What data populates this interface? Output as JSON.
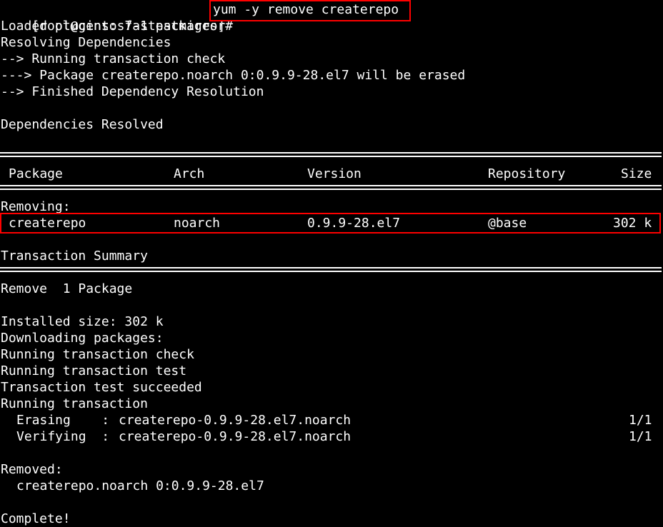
{
  "prompt": "[root@centos7-1 packages]#",
  "command": "yum -y remove createrepo",
  "lines": {
    "loaded_plugins": "Loaded plugins: fastestmirror",
    "resolving": "Resolving Dependencies",
    "running_check": "--> Running transaction check",
    "package_erase": "---> Package createrepo.noarch 0:0.9.9-28.el7 will be erased",
    "finished": "--> Finished Dependency Resolution",
    "deps_resolved": "Dependencies Resolved",
    "removing": "Removing:",
    "txn_summary": "Transaction Summary",
    "remove_count": "Remove  1 Package",
    "installed_size": "Installed size: 302 k",
    "downloading": "Downloading packages:",
    "run_check": "Running transaction check",
    "run_test": "Running transaction test",
    "test_ok": "Transaction test succeeded",
    "run_txn": "Running transaction",
    "removed": "Removed:",
    "removed_pkg": "createrepo.noarch 0:0.9.9-28.el7",
    "complete": "Complete!"
  },
  "table": {
    "headers": {
      "package": "Package",
      "arch": "Arch",
      "version": "Version",
      "repository": "Repository",
      "size": "Size"
    },
    "row": {
      "package": "createrepo",
      "arch": "noarch",
      "version": "0.9.9-28.el7",
      "repository": "@base",
      "size": "302 k"
    }
  },
  "steps": [
    {
      "action": "Erasing    :",
      "target": "createrepo-0.9.9-28.el7.noarch",
      "progress": "1/1"
    },
    {
      "action": "Verifying  :",
      "target": "createrepo-0.9.9-28.el7.noarch",
      "progress": "1/1"
    }
  ],
  "colors": {
    "background": "#000000",
    "foreground": "#ffffff",
    "highlight": "#ff0000"
  }
}
